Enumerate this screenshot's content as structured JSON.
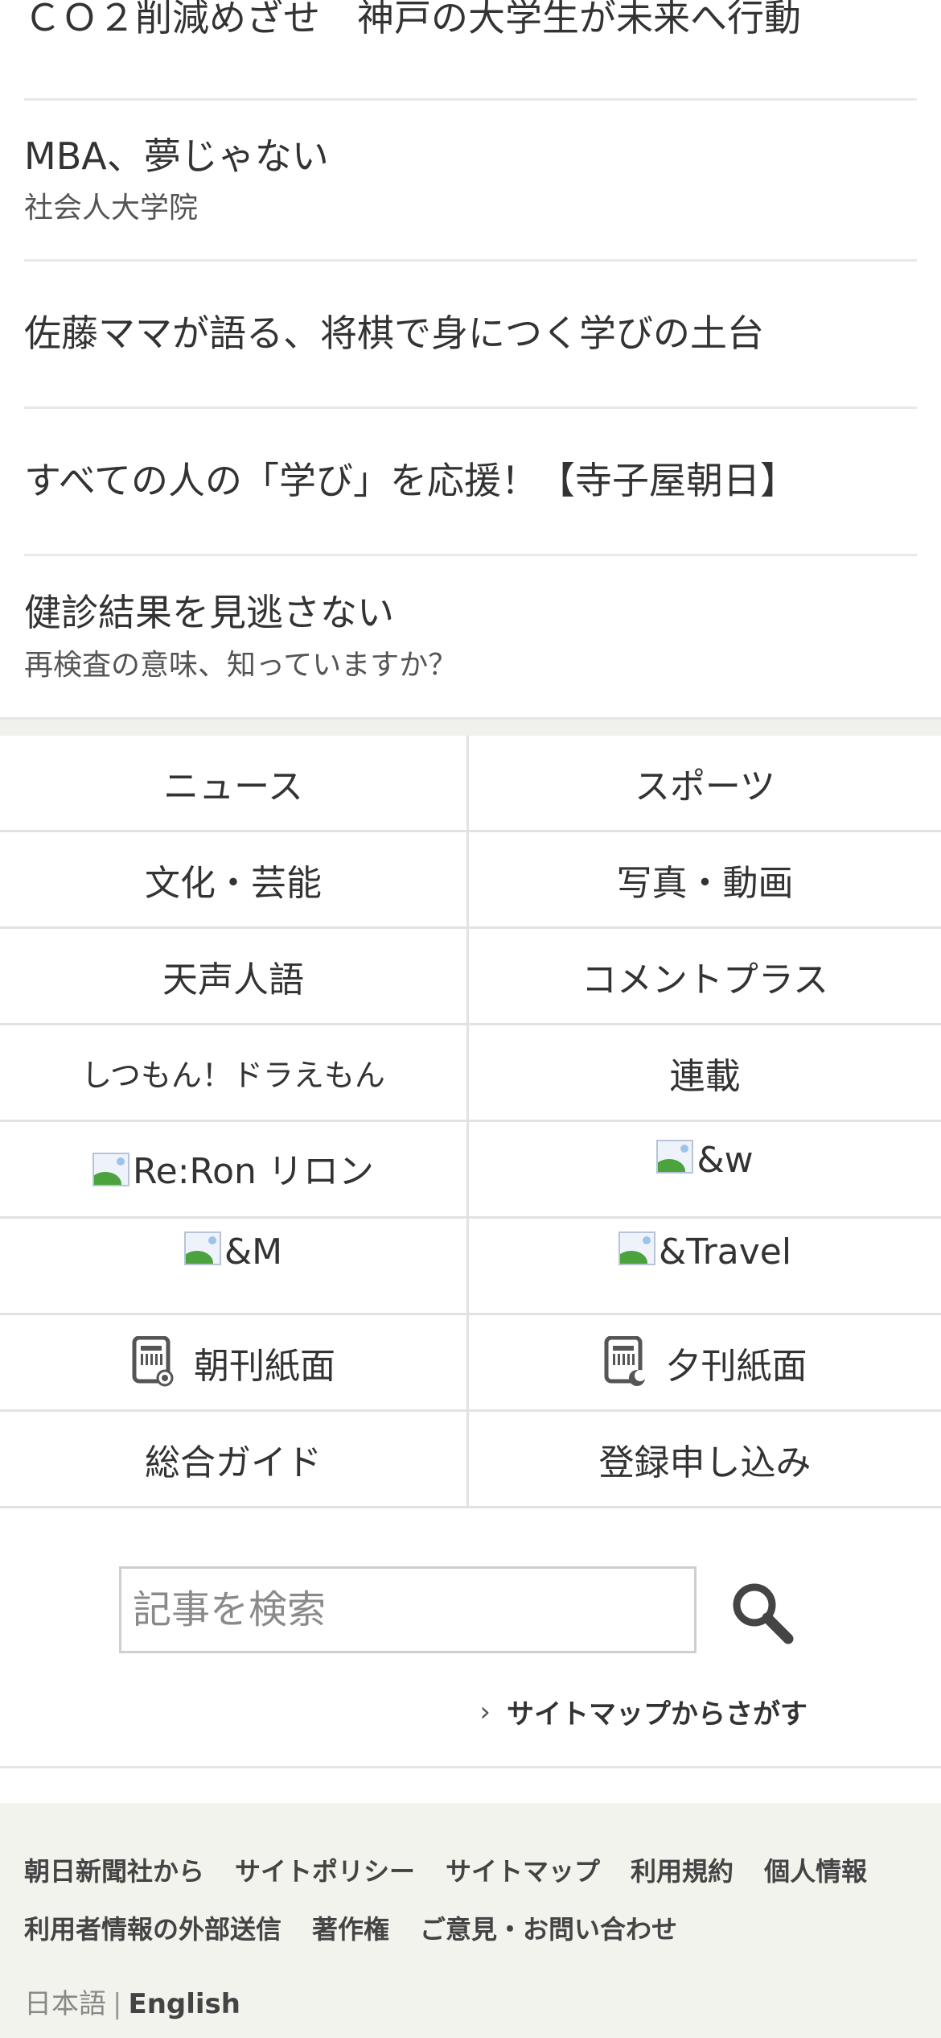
{
  "articles": [
    {
      "title": "ＣＯ２削減めざせ　神戸の大学生が未来へ行動"
    },
    {
      "title": "MBA、夢じゃない",
      "sub": "社会人大学院"
    },
    {
      "title": "佐藤ママが語る、将棋で身につく学びの土台"
    },
    {
      "title": "すべての人の「学び」を応援！【寺子屋朝日】"
    },
    {
      "title": "健診結果を見逃さない",
      "sub": "再検査の意味、知っていますか？"
    }
  ],
  "nav": [
    "ニュース",
    "スポーツ",
    "文化・芸能",
    "写真・動画",
    "天声人語",
    "コメントプラス",
    "しつもん！ドラえもん",
    "連載",
    "Re:Ron リロン",
    "&w",
    "&M",
    "&Travel",
    "朝刊紙面",
    "夕刊紙面",
    "総合ガイド",
    "登録申し込み"
  ],
  "search": {
    "placeholder": "記事を検索",
    "sitemap_label": "サイトマップからさがす"
  },
  "footer": {
    "links_row1": [
      "朝日新聞社から",
      "サイトポリシー",
      "サイトマップ",
      "利用規約",
      "個人情報"
    ],
    "links_row2": [
      "利用者情報の外部送信",
      "著作権",
      "ご意見・お問い合わせ"
    ],
    "lang_ja": "日本語",
    "lang_sep": "|",
    "lang_en": "English"
  },
  "icons": {
    "image_placeholder": "broken-image-icon",
    "morning": "morning-paper-icon",
    "evening": "evening-paper-icon",
    "search": "search-icon",
    "chevron": "chevron-right-icon"
  }
}
